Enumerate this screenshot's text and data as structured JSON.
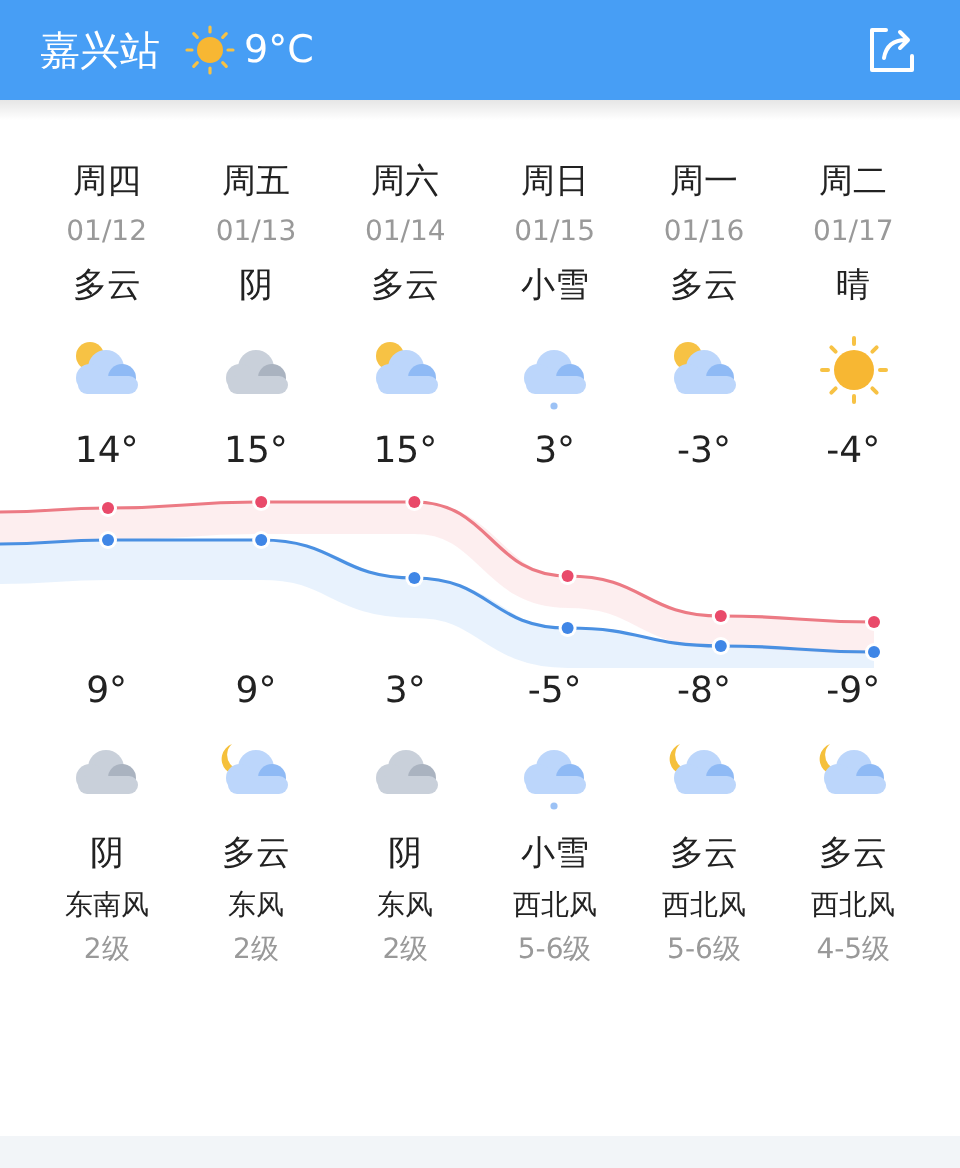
{
  "header": {
    "station": "嘉兴站",
    "temperature": "9°C"
  },
  "days": [
    {
      "weekday": "周四",
      "date": "01/12",
      "day": {
        "condition": "多云",
        "kind": "partly"
      },
      "high": "14°",
      "low": "9°",
      "night": {
        "kind": "overcast",
        "condition": "阴"
      },
      "wind": "东南风",
      "wind_level": "2级"
    },
    {
      "weekday": "周五",
      "date": "01/13",
      "day": {
        "condition": "阴",
        "kind": "overcast"
      },
      "high": "15°",
      "low": "9°",
      "night": {
        "kind": "night_partly",
        "condition": "多云"
      },
      "wind": "东风",
      "wind_level": "2级"
    },
    {
      "weekday": "周六",
      "date": "01/14",
      "day": {
        "condition": "多云",
        "kind": "partly"
      },
      "high": "15°",
      "low": "3°",
      "night": {
        "kind": "overcast",
        "condition": "阴"
      },
      "wind": "东风",
      "wind_level": "2级"
    },
    {
      "weekday": "周日",
      "date": "01/15",
      "day": {
        "condition": "小雪",
        "kind": "snow"
      },
      "high": "3°",
      "low": "-5°",
      "night": {
        "kind": "snow",
        "condition": "小雪"
      },
      "wind": "西北风",
      "wind_level": "5-6级"
    },
    {
      "weekday": "周一",
      "date": "01/16",
      "day": {
        "condition": "多云",
        "kind": "partly"
      },
      "high": "-3°",
      "low": "-8°",
      "night": {
        "kind": "night_partly",
        "condition": "多云"
      },
      "wind": "西北风",
      "wind_level": "5-6级"
    },
    {
      "weekday": "周二",
      "date": "01/17",
      "day": {
        "condition": "晴",
        "kind": "sunny"
      },
      "high": "-4°",
      "low": "-9°",
      "night": {
        "kind": "night_partly",
        "condition": "多云"
      },
      "wind": "西北风",
      "wind_level": "4-5级"
    }
  ]
}
